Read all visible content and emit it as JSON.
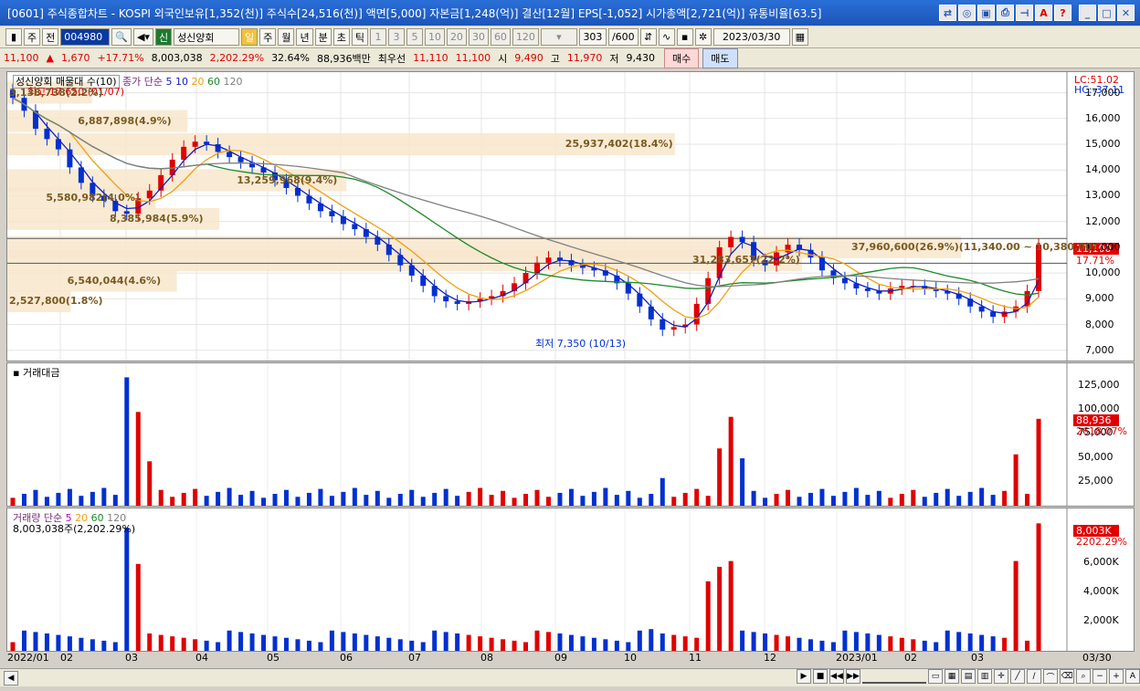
{
  "window": {
    "title": "[0601] 주식종합차트 - KOSPI 외국인보유[1,352(천)] 주식수[24,516(천)] 액면[5,000] 자본금[1,248(억)] 결산[12월] EPS[-1,052] 시가총액[2,721(억)] 유통비율[63.5]"
  },
  "toolbar": {
    "market": "주",
    "prev": "전",
    "code": "004980",
    "stock_name": "성신양회",
    "new_label": "신",
    "periods": [
      "일",
      "주",
      "월",
      "년",
      "분",
      "초",
      "틱"
    ],
    "intervals": [
      "1",
      "3",
      "5",
      "10",
      "20",
      "30",
      "60",
      "120"
    ],
    "count": "303",
    "count_total": "/600",
    "date": "2023/03/30"
  },
  "quote": {
    "price": "11,100",
    "change": "1,670",
    "change_pct": "+17.71%",
    "volume": "8,003,038",
    "volume_pct": "2,202.29%",
    "turnover_pct": "32.64%",
    "trade_value": "88,936백만",
    "best_ask_label": "최우선",
    "best_ask": "11,110",
    "best_bid": "11,100",
    "open_label": "시",
    "open": "9,490",
    "high_label": "고",
    "high": "11,970",
    "low_label": "저",
    "low": "9,430",
    "buy": "매수",
    "sell": "매도"
  },
  "price_panel": {
    "legend_name": "성신양회 매물대 수(10)",
    "legend_ma": "종가 단순",
    "ma_periods": [
      "5",
      "10",
      "20",
      "60",
      "120"
    ],
    "high_note": "최고 17,650 (01/07)",
    "low_note": "최저 7,350 (10/13)",
    "lc": "LC:51.02",
    "hc": "HC:-37.11",
    "last_price": "11,100",
    "last_pct": "17.71%",
    "y_ticks": [
      "17,000",
      "16,000",
      "15,000",
      "14,000",
      "13,000",
      "12,000",
      "11,000",
      "10,000",
      "9,000",
      "8,000",
      "7,000"
    ],
    "volume_profile": [
      {
        "label": "6,887,898(4.9%)"
      },
      {
        "label": "25,937,402(18.4%)"
      },
      {
        "label": "13,259,968(9.4%)"
      },
      {
        "label": "5,580,982(4.0%)"
      },
      {
        "label": "8,385,984(5.9%)"
      },
      {
        "label": "37,960,600(26.9%)(11,340.00 ~ 10,380.00)"
      },
      {
        "label": "31,283,657(22.2%)"
      },
      {
        "label": "6,540,044(4.6%)"
      },
      {
        "label": "2,527,800(1.8%)"
      },
      {
        "label": "3,138,738(2.2%)"
      }
    ]
  },
  "value_panel": {
    "title": "거래대금",
    "y_ticks": [
      "125,000",
      "100,000",
      "75,000",
      "50,000",
      "25,000"
    ],
    "last": "88,936",
    "last_pct": "2618.07%"
  },
  "volume_panel": {
    "title": "거래량 단순",
    "ma_periods": [
      "5",
      "20",
      "60",
      "120"
    ],
    "subtitle": "8,003,038주(2,202.29%)",
    "y_ticks": [
      "6,000K",
      "4,000K",
      "2,000K"
    ],
    "last": "8,003K",
    "last_pct": "2202.29%"
  },
  "x_axis": [
    "2022/01",
    "02",
    "03",
    "04",
    "05",
    "06",
    "07",
    "08",
    "09",
    "10",
    "11",
    "12",
    "2023/01",
    "02",
    "03",
    "03/30"
  ],
  "chart_data": {
    "type": "candlestick",
    "price_range": [
      6600,
      17800
    ],
    "closes": [
      16800,
      16300,
      15600,
      15200,
      14800,
      14100,
      13500,
      13000,
      12800,
      12400,
      12300,
      12900,
      13200,
      13800,
      14400,
      14900,
      15100,
      15000,
      14700,
      14500,
      14300,
      14100,
      13900,
      13600,
      13300,
      13000,
      12700,
      12400,
      12200,
      11900,
      11700,
      11400,
      11100,
      10700,
      10300,
      9900,
      9500,
      9100,
      8900,
      8800,
      8900,
      9000,
      9100,
      9300,
      9600,
      10000,
      10400,
      10600,
      10500,
      10300,
      10200,
      10100,
      9900,
      9600,
      9200,
      8700,
      8200,
      7800,
      7900,
      8000,
      8800,
      9800,
      11000,
      11400,
      11200,
      10500,
      10300,
      10800,
      11100,
      10900,
      10600,
      10100,
      9800,
      9600,
      9400,
      9300,
      9200,
      9400,
      9500,
      9500,
      9400,
      9300,
      9200,
      9000,
      8700,
      8500,
      8300,
      8500,
      8700,
      9300,
      11100
    ],
    "colors": {
      "up": "#e00000",
      "down": "#0030d0",
      "ma5": "#1020c0",
      "ma20": "#f0a010",
      "ma60": "#1a8a2a",
      "ma120": "#808080"
    }
  }
}
